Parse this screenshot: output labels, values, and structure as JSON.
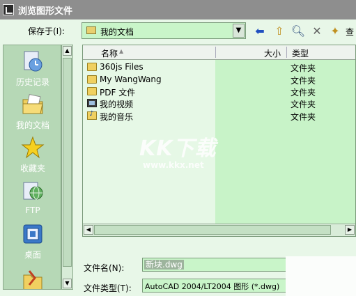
{
  "window": {
    "title": "浏览图形文件"
  },
  "save_in": {
    "label": "保存于(I):",
    "value": "我的文档"
  },
  "toolbar": {
    "view_label": "查"
  },
  "places": [
    {
      "label": "历史记录",
      "icon": "history-icon"
    },
    {
      "label": "我的文档",
      "icon": "my-documents-icon"
    },
    {
      "label": "收藏夹",
      "icon": "favorites-star-icon"
    },
    {
      "label": "FTP",
      "icon": "ftp-icon"
    },
    {
      "label": "桌面",
      "icon": "desktop-icon"
    }
  ],
  "columns": {
    "name": "名称",
    "size": "大小",
    "type": "类型"
  },
  "files": [
    {
      "name": "360js Files",
      "type": "文件夹",
      "icon": "folder-icon"
    },
    {
      "name": "My WangWang",
      "type": "文件夹",
      "icon": "folder-icon"
    },
    {
      "name": "PDF 文件",
      "type": "文件夹",
      "icon": "folder-icon"
    },
    {
      "name": "我的视频",
      "type": "文件夹",
      "icon": "video-folder-icon"
    },
    {
      "name": "我的音乐",
      "type": "文件夹",
      "icon": "music-folder-icon"
    }
  ],
  "watermark": {
    "brand": "KK下载",
    "url": "www.kkx.net"
  },
  "file_name": {
    "label": "文件名(N):",
    "value": "新块.dwg"
  },
  "file_type": {
    "label": "文件类型(T):",
    "value": "AutoCAD 2004/LT2004 图形 (*.dwg)"
  }
}
